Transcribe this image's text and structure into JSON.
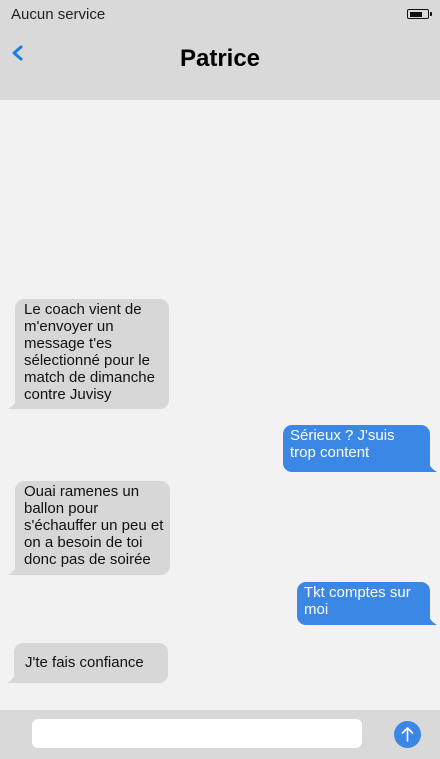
{
  "status_bar": {
    "carrier": "Aucun service",
    "battery_icon": "battery-icon",
    "battery_level": 0.8
  },
  "header": {
    "back_icon": "chevron-left-icon",
    "contact_name": "Patrice"
  },
  "messages": [
    {
      "direction": "received",
      "text": "Le coach vient de m'envoyer un message t'es sélectionné pour le match de dimanche contre Juvisy"
    },
    {
      "direction": "sent",
      "text": "Sérieux ? J'suis trop content"
    },
    {
      "direction": "received",
      "text": "Ouai ramenes un ballon pour s'échauffer un peu et on a besoin de toi donc pas de soirée"
    },
    {
      "direction": "sent",
      "text": "Tkt comptes sur moi"
    },
    {
      "direction": "received",
      "text": "J'te fais confiance"
    }
  ],
  "composer": {
    "value": "",
    "placeholder": "",
    "send_icon": "arrow-up-icon"
  },
  "colors": {
    "header_bg": "#d9d9d9",
    "thread_bg": "#f2f2f2",
    "sent_bubble": "#3a87e6",
    "received_bubble": "#d7d7d7",
    "accent": "#1a7ee6"
  }
}
